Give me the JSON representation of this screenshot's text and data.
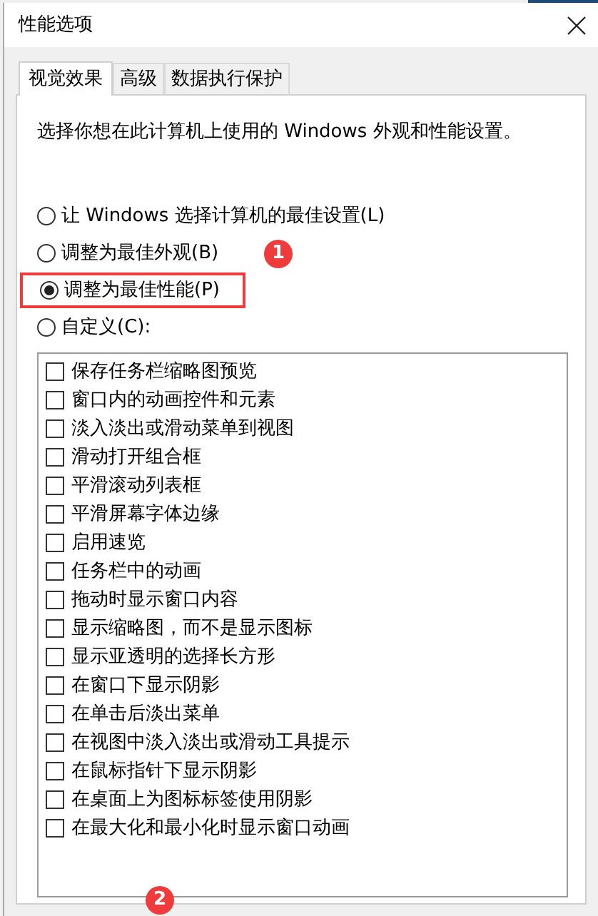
{
  "window": {
    "title": "性能选项"
  },
  "tabs": [
    {
      "label": "视觉效果",
      "selected": true
    },
    {
      "label": "高级",
      "selected": false
    },
    {
      "label": "数据执行保护",
      "selected": false
    }
  ],
  "description": "选择你想在此计算机上使用的 Windows 外观和性能设置。",
  "options": [
    {
      "label": "让 Windows 选择计算机的最佳设置(L)",
      "selected": false,
      "highlighted": false
    },
    {
      "label": "调整为最佳外观(B)",
      "selected": false,
      "highlighted": false,
      "badge": "1"
    },
    {
      "label": "调整为最佳性能(P)",
      "selected": true,
      "highlighted": true
    },
    {
      "label": "自定义(C):",
      "selected": false,
      "highlighted": false
    }
  ],
  "effects": [
    {
      "label": "保存任务栏缩略图预览",
      "checked": false
    },
    {
      "label": "窗口内的动画控件和元素",
      "checked": false
    },
    {
      "label": "淡入淡出或滑动菜单到视图",
      "checked": false
    },
    {
      "label": "滑动打开组合框",
      "checked": false
    },
    {
      "label": "平滑滚动列表框",
      "checked": false
    },
    {
      "label": "平滑屏幕字体边缘",
      "checked": false
    },
    {
      "label": "启用速览",
      "checked": false
    },
    {
      "label": "任务栏中的动画",
      "checked": false
    },
    {
      "label": "拖动时显示窗口内容",
      "checked": false
    },
    {
      "label": "显示缩略图，而不是显示图标",
      "checked": false
    },
    {
      "label": "显示亚透明的选择长方形",
      "checked": false
    },
    {
      "label": "在窗口下显示阴影",
      "checked": false
    },
    {
      "label": "在单击后淡出菜单",
      "checked": false
    },
    {
      "label": "在视图中淡入淡出或滑动工具提示",
      "checked": false
    },
    {
      "label": "在鼠标指针下显示阴影",
      "checked": false
    },
    {
      "label": "在桌面上为图标标签使用阴影",
      "checked": false
    },
    {
      "label": "在最大化和最小化时显示窗口动画",
      "checked": false
    }
  ],
  "bottom_badge": "2"
}
